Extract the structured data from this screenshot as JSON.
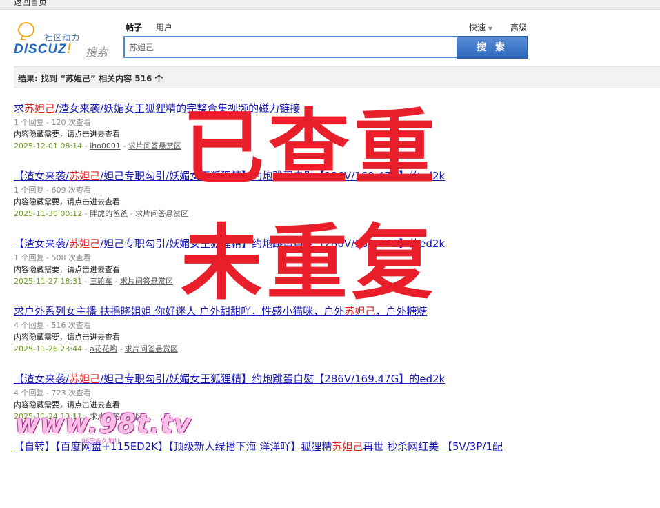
{
  "topbar": {
    "back_label": "返回首页"
  },
  "header": {
    "community_text": "社区动力",
    "brand_main": "DISCUZ",
    "brand_excl": "!",
    "brand_search": "搜索",
    "tabs": [
      {
        "label": "帖子",
        "active": true
      },
      {
        "label": "用户",
        "active": false
      }
    ],
    "quick_label": "快速",
    "advanced_label": "高级",
    "search_value": "苏妲己",
    "search_button": "搜 索"
  },
  "summary": {
    "text": "结果: 找到 “苏妲己” 相关内容 516 个"
  },
  "results": [
    {
      "title_parts": [
        "求",
        "苏妲己",
        "/渣女来袭/妖媚女王狐狸精的完整合集视频的磁力链接"
      ],
      "meta": "1 个回复 - 120 次查看",
      "hidden": "内容隐藏需要，请点击进去查看",
      "date": "2025-12-01 08:14",
      "user": "iho0001",
      "forum": "求片问答悬赏区"
    },
    {
      "title_parts": [
        "【渣女来袭/",
        "苏妲己",
        "/妲己专职勾引/妖媚女王狐狸精】约炮跳蛋自慰【286V/169.47G】的ed2k"
      ],
      "meta": "1 个回复 - 609 次查看",
      "hidden": "内容隐藏需要，请点击进去查看",
      "date": "2025-11-30 00:12",
      "user": "胖虎的爸爸",
      "forum": "求片问答悬赏区"
    },
    {
      "title_parts": [
        "【渣女来袭/",
        "苏妲己",
        "/妲己专职勾引/妖媚女王狐狸精】约炮跳蛋自慰【286V/169.47G】的ed2k"
      ],
      "meta": "1 个回复 - 508 次查看",
      "hidden": "内容隐藏需要，请点击进去查看",
      "date": "2025-11-27 18:31",
      "user": "三轮车",
      "forum": "求片问答悬赏区"
    },
    {
      "title_parts": [
        "求户外系列女主播 扶摇晓姐姐 你好迷人 户外甜甜吖，性感小猫咪，户外",
        "苏妲己",
        "，户外糖糖"
      ],
      "meta": "4 个回复 - 516 次查看",
      "hidden": "内容隐藏需要，请点击进去查看",
      "date": "2025-11-26 23:44",
      "user": "a花花哟",
      "forum": "求片问答悬赏区"
    },
    {
      "title_parts": [
        "【渣女来袭/",
        "苏妲己",
        "/妲己专职勾引/妖媚女王狐狸精】约炮跳蛋自慰【286V/169.47G】的ed2k"
      ],
      "meta": "4 个回复 - 723 次查看",
      "hidden": "内容隐藏需要，请点击进去查看",
      "date": "2025-11-24 13:11",
      "user": "",
      "forum": "求片问答悬赏区"
    },
    {
      "title_parts": [
        "【自转】【百度网盘+115ED2K】【顶级新人绿播下海 洋洋吖】狐狸精",
        "苏妲己",
        "再世 秒杀网红美 【5V/3P/1配"
      ],
      "meta": "",
      "hidden": "",
      "date": "",
      "user": "",
      "forum": ""
    }
  ],
  "overlay": {
    "line1": "已查重",
    "line2": "未重复"
  },
  "watermark": {
    "main": "www.98t.tv",
    "sub": "98堂永久地址"
  },
  "colors": {
    "stamp": "#e81f2b",
    "link": "#1a1ab5",
    "highlight": "#e02020",
    "date": "#6a9b1f",
    "button": "#2d67bd"
  }
}
